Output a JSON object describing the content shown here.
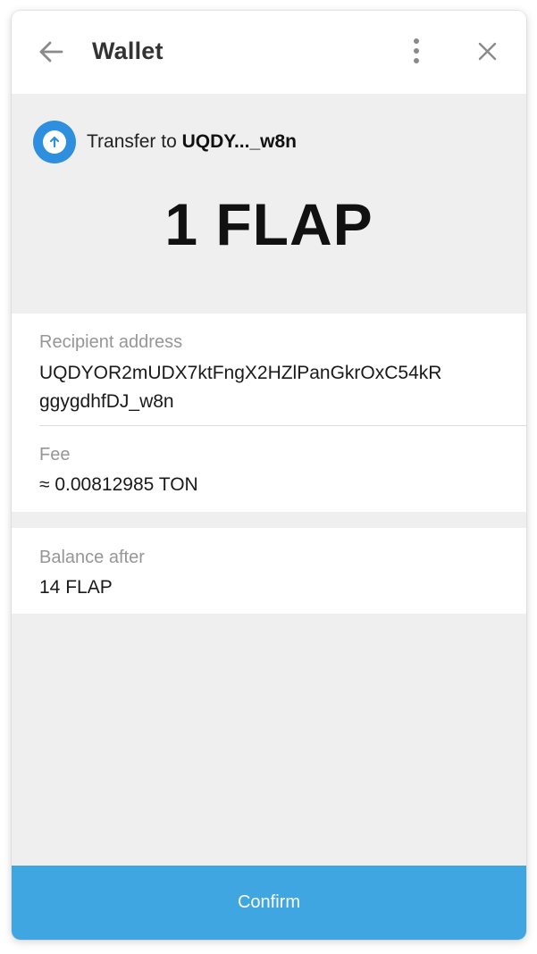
{
  "header": {
    "title": "Wallet"
  },
  "transfer": {
    "prefix": "Transfer to ",
    "short_address": "UQDY..._w8n",
    "amount": "1 FLAP"
  },
  "recipient": {
    "label": "Recipient address",
    "address_line1": "UQDYOR2mUDX7ktFngX2HZlPanGkrOxC54kR",
    "address_line2": "ggygdhfDJ_w8n"
  },
  "fee": {
    "label": "Fee",
    "value": "≈ 0.00812985 TON"
  },
  "balance": {
    "label": "Balance after",
    "value": "14 FLAP"
  },
  "actions": {
    "confirm_label": "Confirm"
  },
  "colors": {
    "accent": "#2d8fde",
    "confirm_button": "#40a6e2",
    "background": "#efefef"
  },
  "icons": {
    "back": "arrow-left-icon",
    "more": "more-vertical-icon",
    "close": "close-icon",
    "transfer": "arrow-up-circle-icon"
  }
}
